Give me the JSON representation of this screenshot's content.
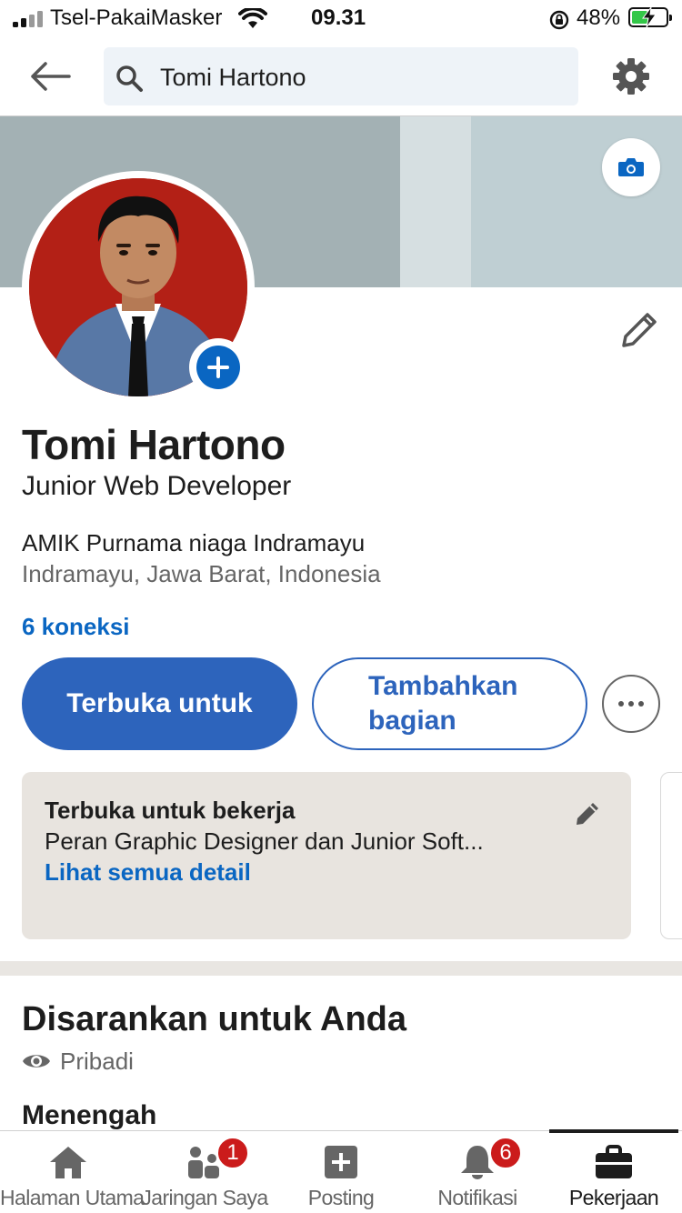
{
  "status_bar": {
    "carrier": "Tsel-PakaiMasker",
    "time": "09.31",
    "battery_percent": "48%",
    "battery_level": 0.48
  },
  "header": {
    "search_value": "Tomi Hartono"
  },
  "profile": {
    "name": "Tomi Hartono",
    "headline": "Junior Web Developer",
    "school": "AMIK Purnama niaga Indramayu",
    "location": "Indramayu, Jawa Barat, Indonesia",
    "connections": "6 koneksi"
  },
  "actions": {
    "open_to_label": "Terbuka untuk",
    "add_section_label_line1": "Tambahkan",
    "add_section_label_line2": "bagian"
  },
  "open_to_work": {
    "title": "Terbuka untuk bekerja",
    "description": "Peran Graphic Designer dan Junior Soft...",
    "link": "Lihat semua detail"
  },
  "suggested": {
    "title": "Disarankan untuk Anda",
    "privacy": "Pribadi",
    "level": "Menengah"
  },
  "colors": {
    "brand_blue": "#0a66c2",
    "button_blue": "#2d64bc",
    "badge_red": "#cb1b1b",
    "cover_gray": "#bfcfd3"
  },
  "bottom_nav": {
    "items": [
      {
        "label": "Halaman Utama",
        "icon": "home-icon"
      },
      {
        "label": "Jaringan Saya",
        "icon": "network-icon",
        "badge": "1"
      },
      {
        "label": "Posting",
        "icon": "post-icon"
      },
      {
        "label": "Notifikasi",
        "icon": "bell-icon",
        "badge": "6"
      },
      {
        "label": "Pekerjaan",
        "icon": "briefcase-icon",
        "active": true
      }
    ]
  }
}
